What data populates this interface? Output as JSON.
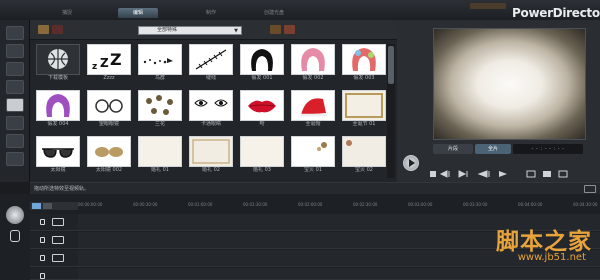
{
  "app": {
    "brand": "PowerDirector"
  },
  "tabs": [
    "捕捉",
    "编辑",
    "制作",
    "创建光盘"
  ],
  "active_tab": "编辑",
  "library": {
    "category_dropdown": "全部特殊",
    "items": [
      {
        "label": "下载模板"
      },
      {
        "label": "Zzzz"
      },
      {
        "label": "鸟群"
      },
      {
        "label": "缝线"
      },
      {
        "label": "假发 001"
      },
      {
        "label": "假发 002"
      },
      {
        "label": "假发 003"
      },
      {
        "label": "假发 004"
      },
      {
        "label": "望眼眼镜"
      },
      {
        "label": "兰花"
      },
      {
        "label": "卡通眼睛"
      },
      {
        "label": "吻"
      },
      {
        "label": "圣诞帽"
      },
      {
        "label": "圣诞节 01"
      },
      {
        "label": "太阳镜"
      },
      {
        "label": "太阳镜 002"
      },
      {
        "label": "婚礼 01"
      },
      {
        "label": "婚礼 02"
      },
      {
        "label": "婚礼 03"
      },
      {
        "label": "宝贝 01"
      },
      {
        "label": "宝贝 02"
      }
    ]
  },
  "preview": {
    "mode_clip": "片段",
    "mode_movie": "全片",
    "timecode": "- - : - - : - -"
  },
  "status": {
    "hint": "拖动所选特效至视频轨。"
  },
  "timeline": {
    "ruler": [
      "00:00:00:00",
      "00:00:30:00",
      "00:01:00:00",
      "00:01:30:00",
      "00:02:00:00",
      "00:02:30:00",
      "00:03:00:00",
      "00:03:30:00",
      "00:04:00:00",
      "00:04:30:00"
    ]
  },
  "watermark": {
    "title": "脚本之家",
    "url": "www.jb51.net"
  },
  "colors": {
    "accent": "#5c6f80",
    "watermark": "#e8a33a",
    "kiss_red": "#d0102a",
    "wig_pink": "#e58aa7"
  }
}
